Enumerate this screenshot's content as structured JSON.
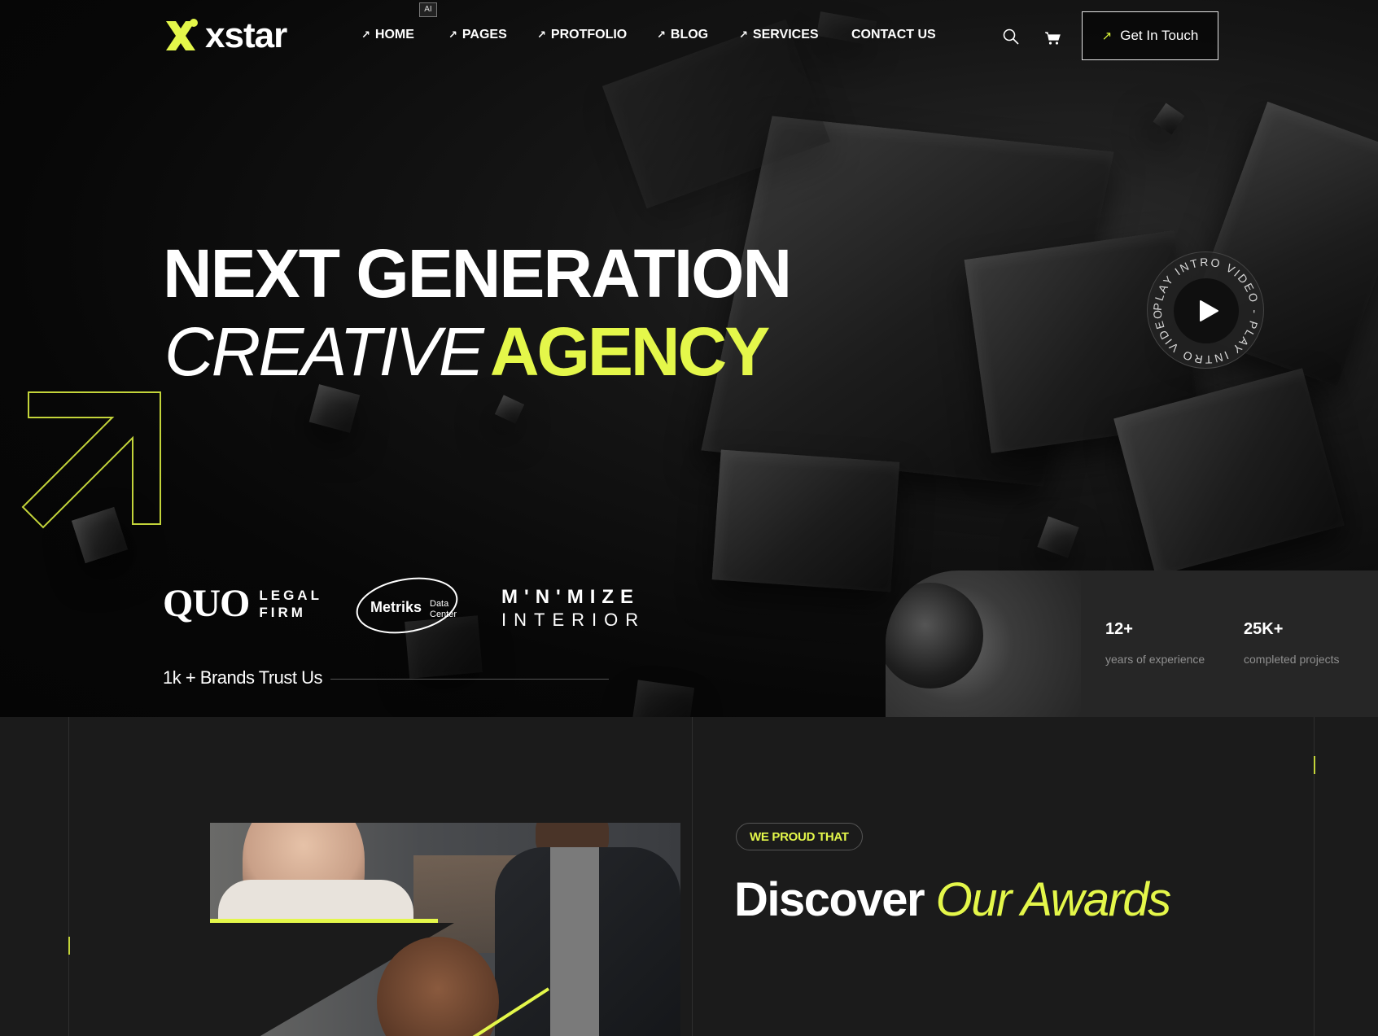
{
  "header": {
    "logo_text": "xstar",
    "ai_badge": "AI",
    "nav": [
      {
        "label": "HOME",
        "arrow": "↗"
      },
      {
        "label": "PAGES",
        "arrow": "↗"
      },
      {
        "label": "PROTFOLIO",
        "arrow": "↗"
      },
      {
        "label": "BLOG",
        "arrow": "↗"
      },
      {
        "label": "SERVICES",
        "arrow": "↗"
      },
      {
        "label": "CONTACT US",
        "arrow": ""
      }
    ],
    "search_icon": "search-icon",
    "cart_icon": "cart-icon",
    "cta_label": "Get In Touch",
    "cta_arrow": "↗"
  },
  "hero": {
    "line1": "NEXT GENERATION",
    "line2_italic": "CREATIVE",
    "line2_highlight": "AGENCY",
    "play_ring_text": "PLAY INTRO VIDEO - PLAY INTRO VIDEO - ",
    "trust_text": "1k + Brands Trust Us",
    "brands": {
      "quo_main": "QUO",
      "quo_line1": "LEGAL",
      "quo_line2": "FIRM",
      "metriks_main": "Metriks",
      "metriks_sub1": "Data",
      "metriks_sub2": "Center",
      "minimize_line1": "M'N'MIZE",
      "minimize_line2": "INTERIOR"
    },
    "stats": [
      {
        "value": "12+",
        "label": "years of experience"
      },
      {
        "value": "25K+",
        "label": "completed projects"
      }
    ]
  },
  "awards": {
    "badge": "WE PROUD THAT",
    "title_white": "Discover",
    "title_yellow": "Our Awards"
  },
  "colors": {
    "accent": "#e4f74a",
    "background": "#0b0b0b",
    "section_bg": "#1b1b1b",
    "stats_bg": "#262626"
  }
}
